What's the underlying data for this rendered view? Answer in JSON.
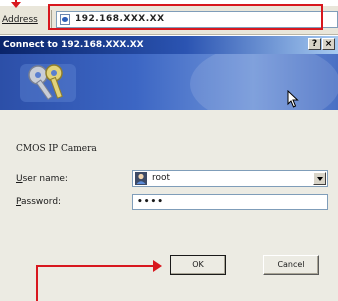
{
  "address_bar": {
    "label": "Address",
    "url": "192.168.XXX.XX"
  },
  "dialog": {
    "title": "Connect to 192.168.XXX.XX",
    "help_label": "?",
    "close_label": "×",
    "camera_name": "CMOS IP Camera",
    "username_label_accel": "U",
    "username_label_rest": "ser name:",
    "username_value": "root",
    "password_label_accel": "P",
    "password_label_rest": "assword:",
    "password_value": "••••",
    "ok_label": "OK",
    "cancel_label": "Cancel"
  },
  "colors": {
    "callout": "#d8171e",
    "title_bar_start": "#0a246a",
    "title_bar_end": "#a6caf0",
    "dialog_bg": "#ecebe3"
  },
  "icons": {
    "page": "page-icon",
    "keys": "keys-icon",
    "cursor": "mouse-cursor-icon",
    "user": "user-icon",
    "dropdown": "chevron-down-icon"
  }
}
